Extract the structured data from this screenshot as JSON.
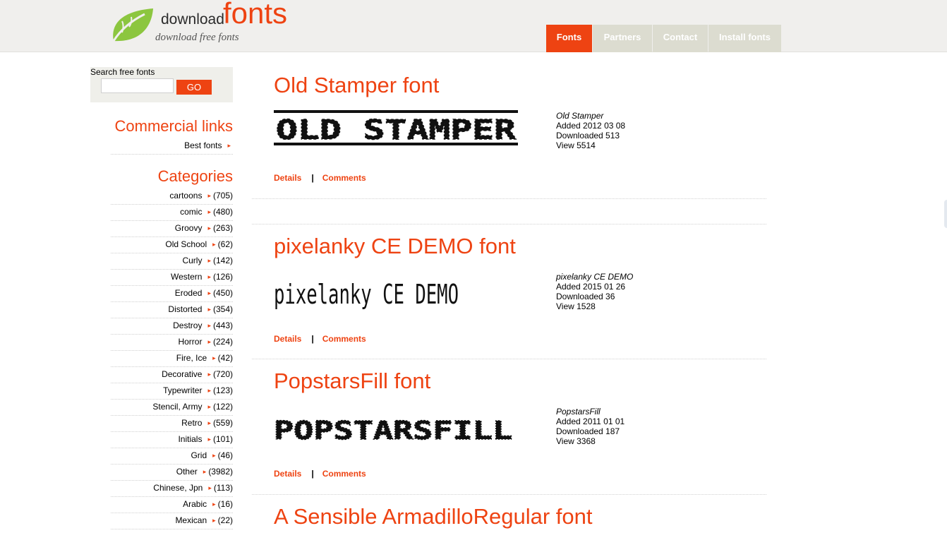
{
  "header": {
    "brand_small": "download",
    "brand_big": "fonts",
    "tagline": "download free fonts",
    "nav": [
      {
        "label": "Fonts",
        "active": true
      },
      {
        "label": "Partners",
        "active": false
      },
      {
        "label": "Contact",
        "active": false
      },
      {
        "label": "Install fonts",
        "active": false
      }
    ]
  },
  "sidebar": {
    "search": {
      "label": "Search free fonts",
      "value": "",
      "placeholder": "",
      "button": "GO"
    },
    "commercial_heading": "Commercial links",
    "commercial": [
      {
        "label": "Best fonts"
      }
    ],
    "categories_heading": "Categories",
    "categories": [
      {
        "label": "cartoons",
        "count": "(705)"
      },
      {
        "label": "comic",
        "count": "(480)"
      },
      {
        "label": "Groovy",
        "count": "(263)"
      },
      {
        "label": "Old School",
        "count": "(62)"
      },
      {
        "label": "Curly",
        "count": "(142)"
      },
      {
        "label": "Western",
        "count": "(126)"
      },
      {
        "label": "Eroded",
        "count": "(450)"
      },
      {
        "label": "Distorted",
        "count": "(354)"
      },
      {
        "label": "Destroy",
        "count": "(443)"
      },
      {
        "label": "Horror",
        "count": "(224)"
      },
      {
        "label": "Fire, Ice",
        "count": "(42)"
      },
      {
        "label": "Decorative",
        "count": "(720)"
      },
      {
        "label": "Typewriter",
        "count": "(123)"
      },
      {
        "label": "Stencil, Army",
        "count": "(122)"
      },
      {
        "label": "Retro",
        "count": "(559)"
      },
      {
        "label": "Initials",
        "count": "(101)"
      },
      {
        "label": "Grid",
        "count": "(46)"
      },
      {
        "label": "Other",
        "count": "(3982)"
      },
      {
        "label": "Chinese, Jpn",
        "count": "(113)"
      },
      {
        "label": "Arabic",
        "count": "(16)"
      },
      {
        "label": "Mexican",
        "count": "(22)"
      }
    ]
  },
  "fonts": [
    {
      "title": "Old Stamper font",
      "preview": "OLD STAMPER",
      "name": "Old Stamper",
      "added": "Added 2012 03 08",
      "downloaded": "Downloaded 513",
      "views": "View 5514",
      "details": "Details",
      "sep": "|",
      "comments": "Comments"
    },
    {
      "title": "pixelanky CE DEMO font",
      "preview": "pixelanky CE DEMO",
      "name": "pixelanky CE DEMO",
      "added": "Added 2015 01 26",
      "downloaded": "Downloaded 36",
      "views": "View 1528",
      "details": "Details",
      "sep": "|",
      "comments": "Comments"
    },
    {
      "title": "PopstarsFill font",
      "preview": "POPSTARSFILL",
      "name": "PopstarsFill",
      "added": "Added 2011 01 01",
      "downloaded": "Downloaded 187",
      "views": "View 3368",
      "details": "Details",
      "sep": "|",
      "comments": "Comments"
    },
    {
      "title": "A Sensible ArmadilloRegular font"
    }
  ],
  "colors": {
    "accent": "#ee4312",
    "nav_inactive": "#dcdcd0",
    "header_bg": "#f0efed"
  }
}
